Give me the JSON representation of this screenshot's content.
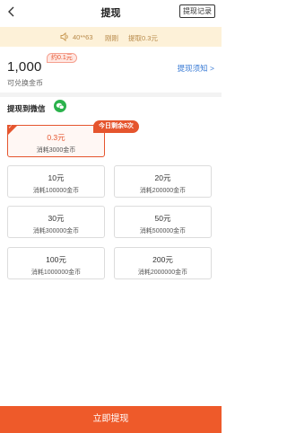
{
  "header": {
    "back_icon": "chevron-left-icon",
    "title": "提现",
    "record_label": "提现记录"
  },
  "notice": {
    "icon": "speaker-icon",
    "user": "40**63",
    "time": "刚刚",
    "message": "提取0.3元"
  },
  "balance": {
    "amount": "1,000",
    "bubble": "约0.1元",
    "label": "可兑换金币",
    "rules_link": "提现须知 >"
  },
  "withdraw": {
    "label": "提现到微信",
    "icon": "wechat-icon",
    "remaining_badge": "今日剩余6次",
    "options": [
      {
        "amount": "0.3元",
        "cost": "消耗3000金币",
        "selected": true
      },
      {
        "amount": "10元",
        "cost": "消耗100000金币",
        "selected": false
      },
      {
        "amount": "20元",
        "cost": "消耗200000金币",
        "selected": false
      },
      {
        "amount": "30元",
        "cost": "消耗300000金币",
        "selected": false
      },
      {
        "amount": "50元",
        "cost": "消耗500000金币",
        "selected": false
      },
      {
        "amount": "100元",
        "cost": "消耗1000000金币",
        "selected": false
      },
      {
        "amount": "200元",
        "cost": "消耗2000000金币",
        "selected": false
      }
    ]
  },
  "submit_label": "立即提现",
  "colors": {
    "accent": "#ee5a2a",
    "link": "#3a7bd5",
    "notice_bg": "#fdf1d8",
    "wechat": "#2bb24c"
  }
}
